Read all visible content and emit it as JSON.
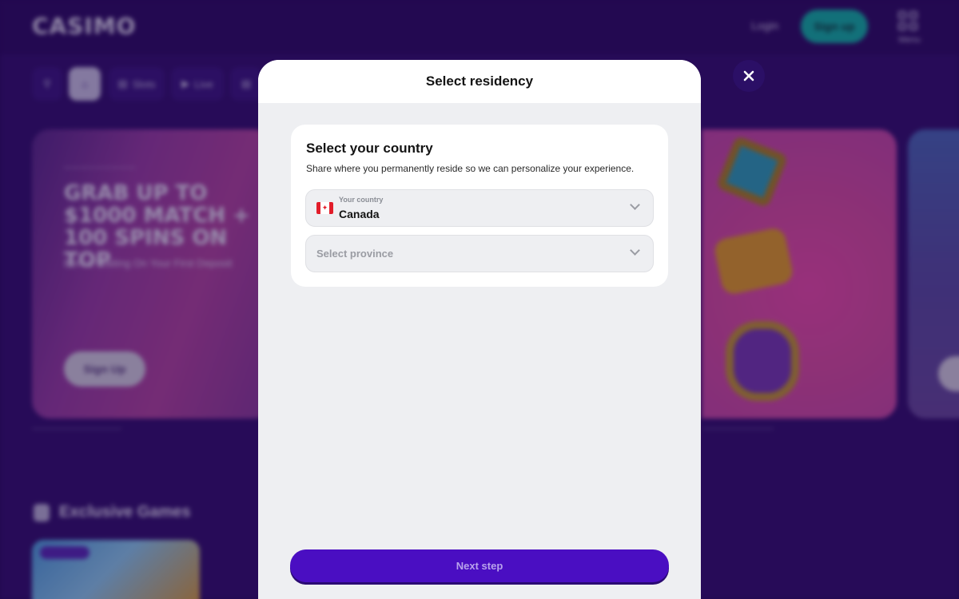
{
  "background": {
    "logo": "CASIMO",
    "login_label": "Login",
    "signup_label": "Sign up",
    "menu_label": "Menu",
    "nav": [
      "Slots",
      "Live"
    ],
    "banner": {
      "headline": "Grab up to $1000 match + 100 spins on top",
      "sub": "Bonus Waiting On Your First Deposit",
      "button": "Sign Up"
    },
    "section_title": "Exclusive Games"
  },
  "modal": {
    "title": "Select residency",
    "card_title": "Select your country",
    "card_subtitle": "Share where you permanently reside so we can personalize your experience.",
    "country": {
      "label": "Your country",
      "value": "Canada",
      "flag_icon": "canada-flag-icon"
    },
    "province": {
      "placeholder": "Select province"
    },
    "next_label": "Next step"
  },
  "colors": {
    "primary": "#4a0ec2",
    "background": "#2a0a5e",
    "modal_bg": "#eeeff2",
    "accent_teal": "#12b8a6"
  }
}
